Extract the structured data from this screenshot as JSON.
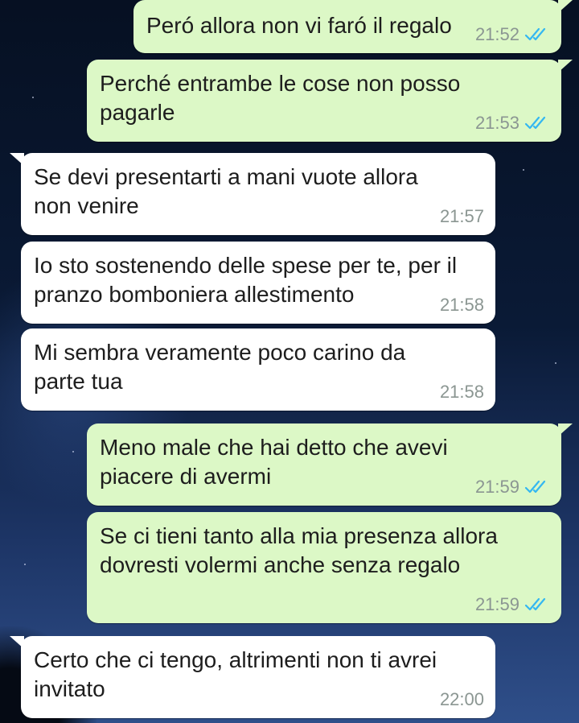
{
  "chat": {
    "messages": [
      {
        "lines": [
          "Peró allora non vi faró il regalo"
        ],
        "time": "21:52"
      },
      {
        "lines": [
          "Perché entrambe le cose non posso",
          "pagarle"
        ],
        "time": "21:53"
      },
      {
        "lines": [
          " Se devi presentarti a mani vuote allora",
          "non venire"
        ],
        "time": "21:57"
      },
      {
        "lines": [
          "Io sto sostenendo delle spese per te, per il",
          "pranzo bomboniera allestimento"
        ],
        "time": "21:58"
      },
      {
        "lines": [
          "Mi sembra veramente poco carino da",
          "parte tua"
        ],
        "time": "21:58"
      },
      {
        "lines": [
          "Meno male che hai detto che avevi",
          "piacere di avermi"
        ],
        "time": "21:59"
      },
      {
        "lines": [
          "Se ci tieni tanto alla mia presenza allora",
          "dovresti volermi anche senza regalo"
        ],
        "time": "21:59"
      },
      {
        "lines": [
          "Certo che ci tengo, altrimenti non ti avrei",
          "invitato"
        ],
        "time": "22:00"
      }
    ]
  },
  "colors": {
    "outgoing_bubble": "#dcf8c6",
    "incoming_bubble": "#ffffff",
    "read_receipt": "#34b7f1",
    "timestamp": "#8b9692"
  },
  "icons": {
    "read_receipt": "double-check-icon"
  }
}
